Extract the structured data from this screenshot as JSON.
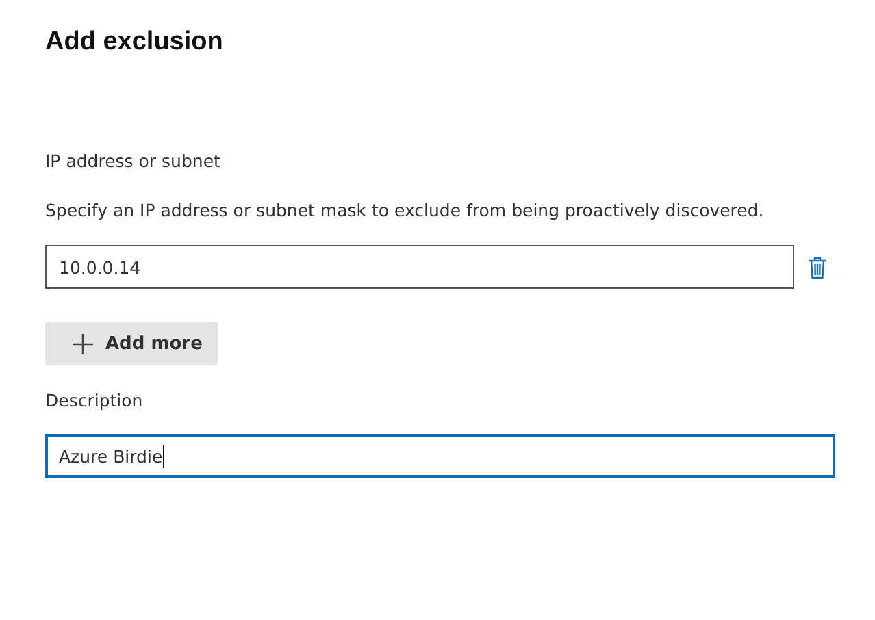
{
  "title": "Add exclusion",
  "ip_section": {
    "label": "IP address or subnet",
    "help": "Specify an IP address or subnet mask to exclude from being proactively discovered.",
    "entries": [
      {
        "value": "10.0.0.14",
        "focused": false
      }
    ]
  },
  "add_button": {
    "label": "Add more"
  },
  "description": {
    "label": "Description",
    "value": "Azure Birdie",
    "focused": true
  }
}
